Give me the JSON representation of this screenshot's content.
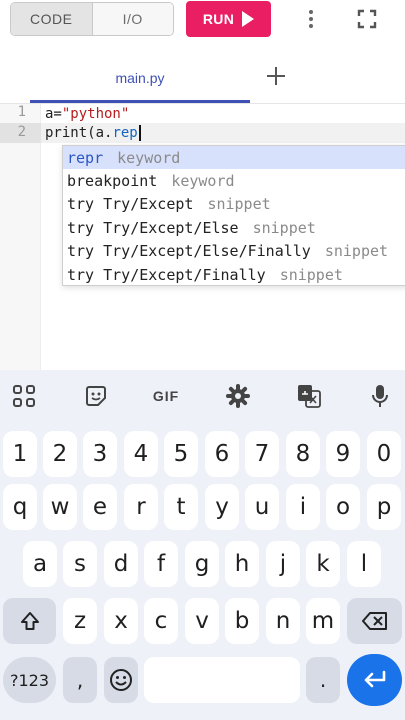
{
  "topbar": {
    "tab_code": "CODE",
    "tab_io": "I/O",
    "run_label": "RUN"
  },
  "tabs": {
    "file_tab": "main.py"
  },
  "editor": {
    "line_numbers": [
      "1",
      "2"
    ],
    "line1": {
      "var": "a=",
      "str": "\"python\""
    },
    "line2": {
      "prefix": "print(a.",
      "attr": "rep"
    }
  },
  "autocomplete": [
    {
      "name": "repr",
      "type": "keyword"
    },
    {
      "name": "breakpoint",
      "type": "keyword"
    },
    {
      "name": "try Try/Except",
      "type": "snippet"
    },
    {
      "name": "try Try/Except/Else",
      "type": "snippet"
    },
    {
      "name": "try Try/Except/Else/Finally",
      "type": "snippet"
    },
    {
      "name": "try Try/Except/Finally",
      "type": "snippet"
    }
  ],
  "keyboard": {
    "toolbar": {
      "gif_label": "GIF"
    },
    "row_numbers": [
      "1",
      "2",
      "3",
      "4",
      "5",
      "6",
      "7",
      "8",
      "9",
      "0"
    ],
    "row1": [
      "q",
      "w",
      "e",
      "r",
      "t",
      "y",
      "u",
      "i",
      "o",
      "p"
    ],
    "row2": [
      "a",
      "s",
      "d",
      "f",
      "g",
      "h",
      "j",
      "k",
      "l"
    ],
    "row3": [
      "z",
      "x",
      "c",
      "v",
      "b",
      "n",
      "m"
    ],
    "symbols_label": "?123",
    "comma_label": ",",
    "period_label": "."
  },
  "colors": {
    "run": "#e91e63",
    "accent": "#3f51b5",
    "enter": "#1a73e8",
    "keyboard_bg": "#eef1f8"
  }
}
